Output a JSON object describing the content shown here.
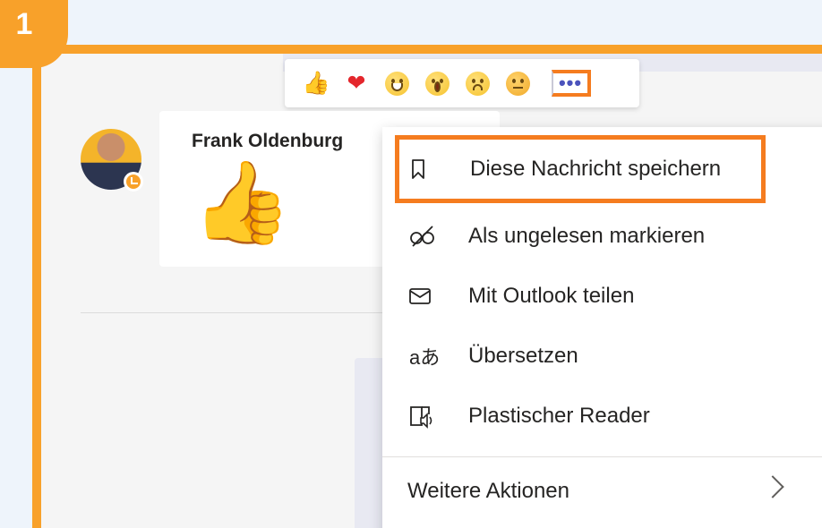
{
  "step": {
    "number": "1"
  },
  "reactions": {
    "items": [
      "thumbs-up",
      "heart",
      "laugh",
      "surprised",
      "sad",
      "angry"
    ],
    "more_label": "•••"
  },
  "message": {
    "sender": "Frank Oldenburg",
    "content_emoji": "👍"
  },
  "context_menu": {
    "items": [
      {
        "label": "Diese Nachricht speichern",
        "icon": "bookmark-icon",
        "highlighted": true
      },
      {
        "label": "Als ungelesen markieren",
        "icon": "unread-icon"
      },
      {
        "label": "Mit Outlook teilen",
        "icon": "mail-icon"
      },
      {
        "label": "Übersetzen",
        "icon": "translate-icon",
        "icon_text": "aあ"
      },
      {
        "label": "Plastischer Reader",
        "icon": "immersive-reader-icon"
      }
    ],
    "more_actions": "Weitere Aktionen"
  },
  "colors": {
    "highlight": "#f57c1f",
    "badge": "#f8a12a",
    "accent": "#4b53bc"
  }
}
